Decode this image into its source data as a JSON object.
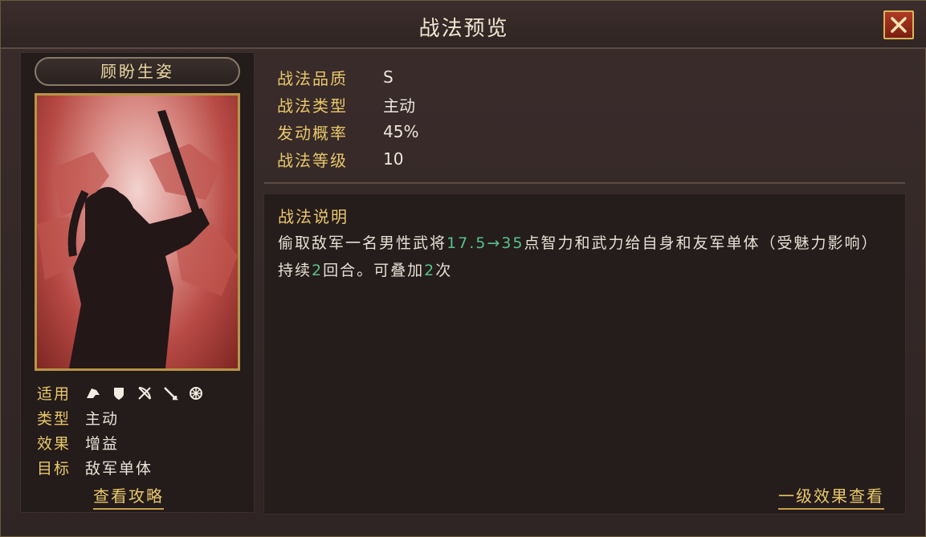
{
  "window": {
    "title": "战法预览"
  },
  "skill": {
    "name": "顾盼生姿",
    "stats": [
      {
        "key": "战法品质",
        "value": "S"
      },
      {
        "key": "战法类型",
        "value": "主动"
      },
      {
        "key": "发动概率",
        "value": "45%"
      },
      {
        "key": "战法等级",
        "value": "10"
      }
    ],
    "info": {
      "apply_label": "适用",
      "apply_icons": [
        "cavalry-icon",
        "shield-icon",
        "bow-icon",
        "spear-icon",
        "wheel-icon"
      ],
      "type_label": "类型",
      "type_value": "主动",
      "effect_label": "效果",
      "effect_value": "增益",
      "target_label": "目标",
      "target_value": "敌军单体"
    },
    "strategy_link": "查看攻略",
    "description": {
      "title": "战法说明",
      "part1": "偷取敌军一名男性武将",
      "value_from": "17.5",
      "arrow": "→",
      "value_to": "35",
      "part2": "点智力和武力给自身和友军单体（受魅力影响）持续",
      "rounds": "2",
      "part3": "回合。可叠加",
      "stacks": "2",
      "part4": "次"
    },
    "level_link": "一级效果查看"
  },
  "colors": {
    "accent_gold": "#e8c86a",
    "highlight_green": "#56c28a",
    "close_red": "#b03a24"
  }
}
